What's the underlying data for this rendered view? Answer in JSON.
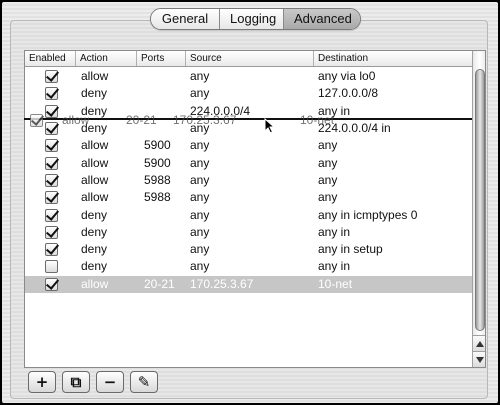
{
  "tabs": [
    {
      "label": "General",
      "active": false
    },
    {
      "label": "Logging",
      "active": false
    },
    {
      "label": "Advanced",
      "active": true
    }
  ],
  "columns": [
    "Enabled",
    "Action",
    "Ports",
    "Source",
    "Destination"
  ],
  "rows": [
    {
      "enabled": true,
      "action": "allow",
      "ports": "",
      "source": "any",
      "destination": "any via lo0"
    },
    {
      "enabled": true,
      "action": "deny",
      "ports": "",
      "source": "any",
      "destination": "127.0.0.0/8"
    },
    {
      "enabled": true,
      "action": "deny",
      "ports": "",
      "source": "224.0.0.0/4",
      "destination": "any in"
    },
    {
      "enabled": true,
      "action": "deny",
      "ports": "",
      "source": "any",
      "destination": "224.0.0.0/4 in"
    },
    {
      "enabled": true,
      "action": "allow",
      "ports": "5900",
      "source": "any",
      "destination": "any"
    },
    {
      "enabled": true,
      "action": "allow",
      "ports": "5900",
      "source": "any",
      "destination": "any"
    },
    {
      "enabled": true,
      "action": "allow",
      "ports": "5988",
      "source": "any",
      "destination": "any"
    },
    {
      "enabled": true,
      "action": "allow",
      "ports": "5988",
      "source": "any",
      "destination": "any"
    },
    {
      "enabled": true,
      "action": "deny",
      "ports": "",
      "source": "any",
      "destination": "any in icmptypes 0"
    },
    {
      "enabled": true,
      "action": "deny",
      "ports": "",
      "source": "any",
      "destination": "any in"
    },
    {
      "enabled": true,
      "action": "deny",
      "ports": "",
      "source": "any",
      "destination": "any in setup"
    },
    {
      "enabled": false,
      "action": "deny",
      "ports": "",
      "source": "any",
      "destination": "any in"
    },
    {
      "enabled": true,
      "action": "allow",
      "ports": "20-21",
      "source": "170.25.3.67",
      "destination": "10-net",
      "selected": true
    }
  ],
  "drag_ghost": {
    "action": "allow",
    "ports": "20-21",
    "source": "170.25.3.67",
    "destination": "10-net"
  },
  "toolbar": [
    {
      "icon": "plus-icon",
      "glyph": "+"
    },
    {
      "icon": "duplicate-icon",
      "glyph": "⧉"
    },
    {
      "icon": "minus-icon",
      "glyph": "−"
    },
    {
      "icon": "pencil-icon",
      "glyph": "✎"
    }
  ],
  "colors": {
    "selection": "#c6c6c6",
    "drop_line": "#111111"
  }
}
